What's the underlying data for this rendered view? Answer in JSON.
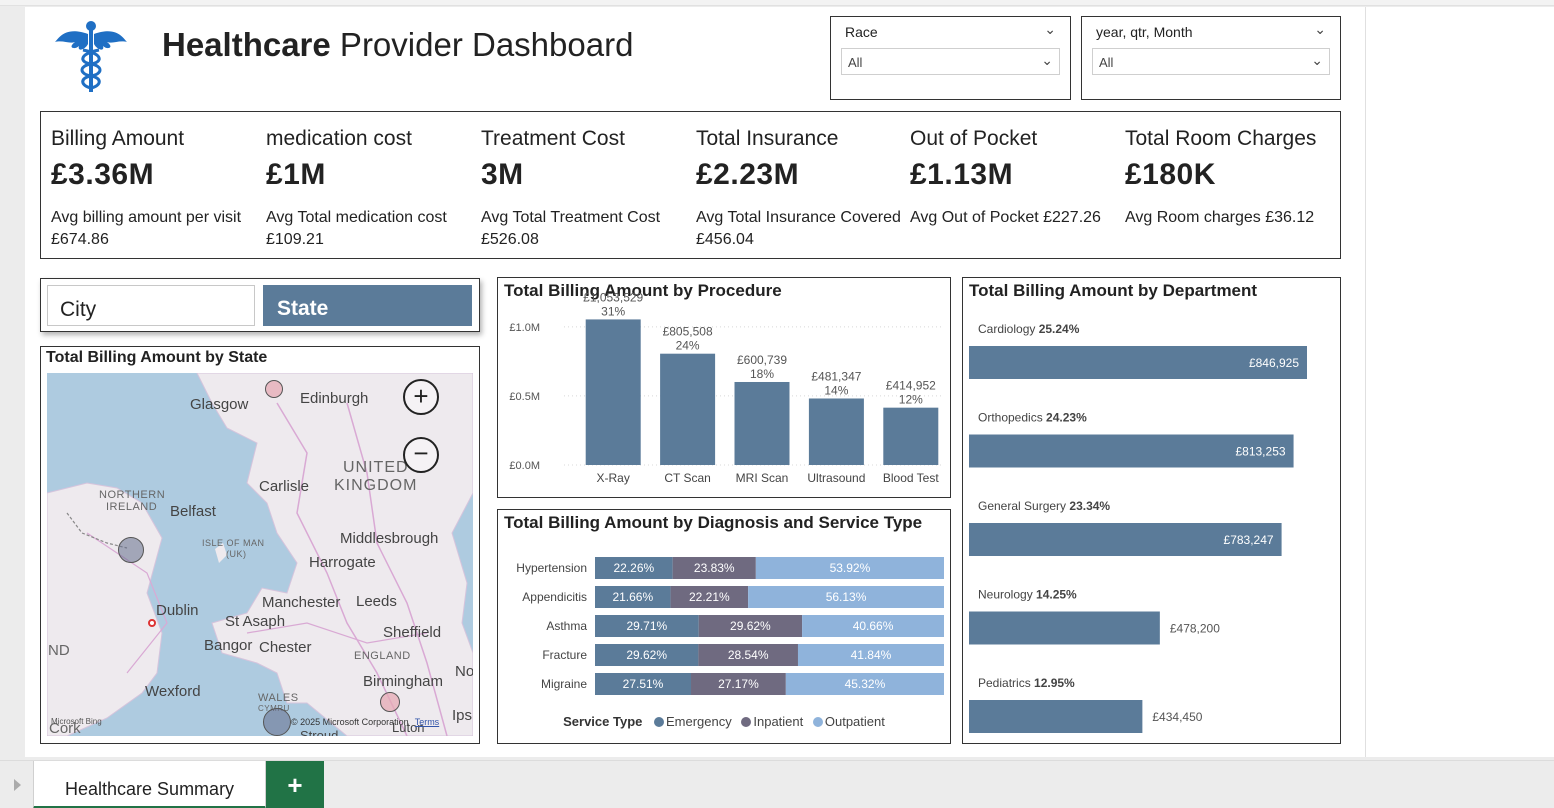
{
  "dashboard": {
    "title_bold": "Healthcare",
    "title_rest": " Provider Dashboard"
  },
  "filters": [
    {
      "title": "Race",
      "value": "All"
    },
    {
      "title": "year, qtr, Month",
      "value": "All"
    }
  ],
  "kpis": [
    {
      "label": "Billing Amount",
      "value": "£3.36M",
      "sub": "Avg billing amount per visit £674.86"
    },
    {
      "label": "medication cost",
      "value": "£1M",
      "sub": "Avg Total medication cost £109.21"
    },
    {
      "label": "Treatment Cost",
      "value": "3M",
      "sub": "Avg Total Treatment Cost £526.08"
    },
    {
      "label": "Total Insurance",
      "value": "£2.23M",
      "sub": "Avg Total Insurance Covered £456.04"
    },
    {
      "label": "Out of Pocket",
      "value": "£1.13M",
      "sub": "Avg Out of Pocket £227.26"
    },
    {
      "label": "Total Room Charges",
      "value": "£180K",
      "sub": "Avg Room charges £36.12"
    }
  ],
  "toggle": {
    "city": "City",
    "state": "State"
  },
  "map": {
    "title": "Total Billing Amount by State",
    "labels": {
      "glasgow": "Glasgow",
      "edinburgh": "Edinburgh",
      "united": "UNITED",
      "kingdom": "KINGDOM",
      "carlisle": "Carlisle",
      "northern": "NORTHERN",
      "ireland": "IRELAND",
      "belfast": "Belfast",
      "isle": "ISLE OF MAN",
      "uk": "(UK)",
      "middlesbrough": "Middlesbrough",
      "harrogate": "Harrogate",
      "dublin": "Dublin",
      "manchester": "Manchester",
      "leeds": "Leeds",
      "stasaph": "St Asaph",
      "sheffield": "Sheffield",
      "bangor": "Bangor",
      "chester": "Chester",
      "england": "ENGLAND",
      "nd": "ND",
      "no": "No",
      "birmingham": "Birmingham",
      "wexford": "Wexford",
      "wales": "WALES",
      "cymru": "CYMRU",
      "ips": "Ips",
      "cork": "Cork",
      "stroud": "Stroud",
      "luton": "Luton"
    },
    "zoom_in": "+",
    "zoom_out": "−",
    "copyright": "© 2025 Microsoft Corporation",
    "terms": "Terms",
    "bing": "Microsoft Bing"
  },
  "procedure_chart": {
    "title": "Total Billing Amount by Procedure",
    "chart_data": {
      "type": "bar",
      "categories": [
        "X-Ray",
        "CT Scan",
        "MRI Scan",
        "Ultrasound",
        "Blood Test"
      ],
      "values": [
        1053529,
        805508,
        600739,
        481347,
        414952
      ],
      "value_labels": [
        "£1,053,529",
        "£805,508",
        "£600,739",
        "£481,347",
        "£414,952"
      ],
      "pct_labels": [
        "31%",
        "24%",
        "18%",
        "14%",
        "12%"
      ],
      "yticks": [
        0,
        500000,
        1000000
      ],
      "ytick_labels": [
        "£0.0M",
        "£0.5M",
        "£1.0M"
      ],
      "ylim": [
        0,
        1100000
      ],
      "grid": true,
      "color": "#5b7b99"
    }
  },
  "diagnosis_chart": {
    "title": "Total Billing Amount by Diagnosis and Service Type",
    "chart_data": {
      "type": "bar",
      "stacked": "100%",
      "orientation": "horizontal",
      "categories": [
        "Hypertension",
        "Appendicitis",
        "Asthma",
        "Fracture",
        "Migraine"
      ],
      "series": [
        {
          "name": "Emergency",
          "values": [
            22.26,
            21.66,
            29.71,
            29.62,
            27.51
          ],
          "labels": [
            "22.26%",
            "21.66%",
            "29.71%",
            "29.62%",
            "27.51%"
          ],
          "color": "#5b7b99"
        },
        {
          "name": "Inpatient",
          "values": [
            23.83,
            22.21,
            29.62,
            28.54,
            27.17
          ],
          "labels": [
            "23.83%",
            "22.21%",
            "29.62%",
            "28.54%",
            "27.17%"
          ],
          "color": "#6f6a80"
        },
        {
          "name": "Outpatient",
          "values": [
            53.92,
            56.13,
            40.66,
            41.84,
            45.32
          ],
          "labels": [
            "53.92%",
            "56.13%",
            "40.66%",
            "41.84%",
            "45.32%"
          ],
          "color": "#8fb3db"
        }
      ],
      "legend_title": "Service Type",
      "legend_position": "bottom"
    }
  },
  "department_chart": {
    "title": "Total Billing Amount by Department",
    "chart_data": {
      "type": "bar",
      "orientation": "horizontal",
      "categories": [
        "Cardiology",
        "Orthopedics",
        "General Surgery",
        "Neurology",
        "Pediatrics"
      ],
      "values": [
        846925,
        813253,
        783247,
        478200,
        434450
      ],
      "value_labels": [
        "£846,925",
        "£813,253",
        "£783,247",
        "£478,200",
        "£434,450"
      ],
      "pct_labels": [
        "25.24%",
        "24.23%",
        "23.34%",
        "14.25%",
        "12.95%"
      ],
      "color": "#5b7b99"
    }
  },
  "tabs": {
    "active": "Healthcare Summary",
    "add": "+"
  }
}
